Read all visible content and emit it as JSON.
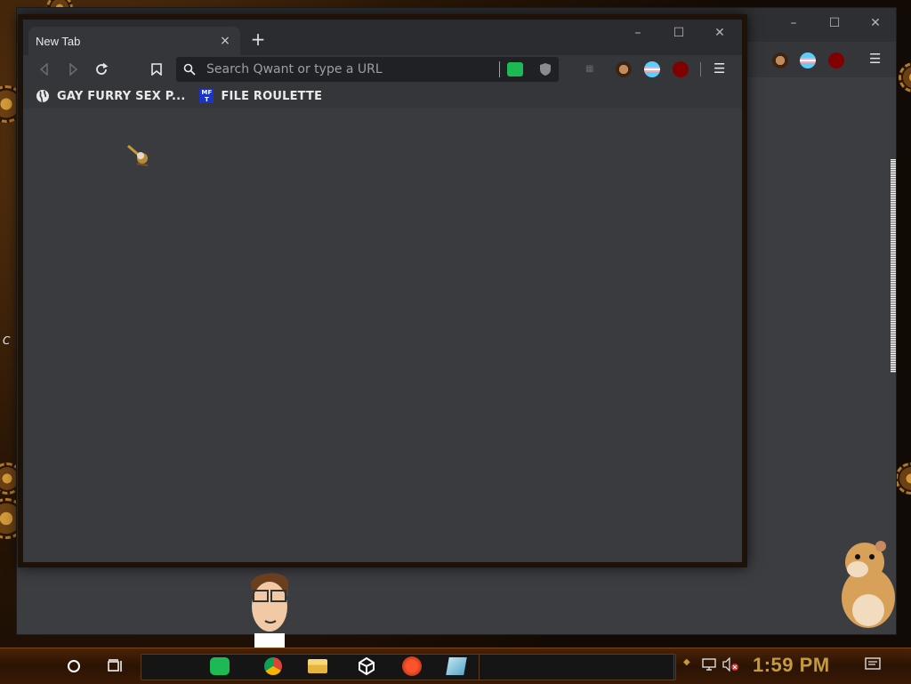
{
  "browser": {
    "tab_title": "New Tab",
    "tab_close": "×",
    "new_tab": "+",
    "window_controls": {
      "minimize": "–",
      "maximize": "☐",
      "close": "✕"
    },
    "search_placeholder": "Search Qwant or type a URL",
    "bookmarks": [
      {
        "label": "GAY FURRY SEX P...",
        "icon": "globe-icon"
      },
      {
        "label": "FILE ROULETTE",
        "icon": "mft-icon",
        "icon_text": "MF T"
      }
    ],
    "menu": "☰"
  },
  "desktop": {
    "left_edge_text": "C"
  },
  "taskbar": {
    "clock": "1:59 PM",
    "apps": [
      "cortana-circle-icon",
      "task-view-icon",
      "spotify-icon",
      "chrome-icon",
      "file-explorer-icon",
      "unity-icon",
      "brave-icon",
      "cube-app-icon"
    ]
  },
  "colors": {
    "accent_spotify": "#1db954",
    "clock": "#c49a3a",
    "window_bg": "#3a3b3f",
    "ublock": "#800000"
  }
}
